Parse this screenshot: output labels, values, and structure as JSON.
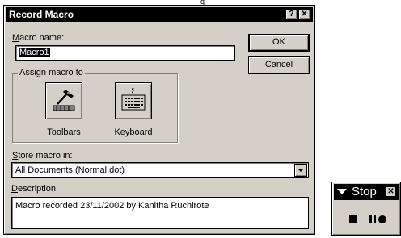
{
  "stray_glyph": "q",
  "dialog": {
    "title": "Record Macro",
    "help_glyph": "?",
    "close_glyph": "✕",
    "macro_name": {
      "label_mnemonic": "M",
      "label_rest": "acro name:",
      "value": "Macro1"
    },
    "ok_label": "OK",
    "cancel_label": "Cancel",
    "assign_group": {
      "legend": "Assign macro to",
      "toolbars": {
        "mnemonic": "T",
        "rest": "oolbars",
        "icon": "hammer-icon"
      },
      "keyboard": {
        "mnemonic": "K",
        "rest": "eyboard",
        "icon": "keyboard-icon"
      }
    },
    "store_in": {
      "label_mnemonic": "S",
      "label_rest": "tore macro in:",
      "value": "All Documents (Normal.dot)"
    },
    "description": {
      "label_mnemonic": "D",
      "label_rest": "escription:",
      "value": "Macro recorded 23/11/2002 by Kanitha Ruchirote"
    }
  },
  "stop_toolbar": {
    "title": "Stop",
    "close_glyph": "✕",
    "buttons": [
      "stop-recording-icon",
      "pause-recording-icon"
    ]
  }
}
